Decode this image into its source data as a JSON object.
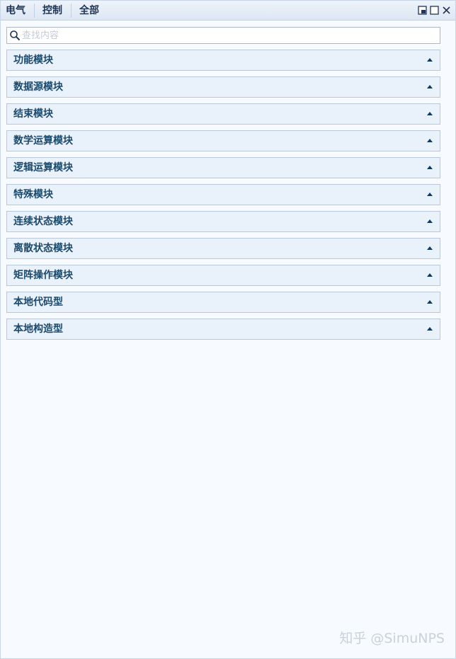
{
  "tabs": [
    {
      "label": "电气"
    },
    {
      "label": "控制"
    },
    {
      "label": "全部"
    }
  ],
  "window_controls": {
    "icons": [
      "restore-icon",
      "maximize-icon",
      "close-icon"
    ]
  },
  "search": {
    "placeholder": "查找内容",
    "value": ""
  },
  "categories": [
    {
      "label": "功能模块"
    },
    {
      "label": "数据源模块"
    },
    {
      "label": "结束模块"
    },
    {
      "label": "数学运算模块"
    },
    {
      "label": "逻辑运算模块"
    },
    {
      "label": "特殊模块"
    },
    {
      "label": "连续状态模块"
    },
    {
      "label": "离散状态模块"
    },
    {
      "label": "矩阵操作模块"
    },
    {
      "label": "本地代码型"
    },
    {
      "label": "本地构造型"
    }
  ],
  "watermark": "知乎 @SimuNPS",
  "colors": {
    "header_bg": "#dde7f3",
    "category_bg": "#e9f1fb",
    "category_text": "#1b4a6b",
    "arrow": "#0d3b66"
  }
}
